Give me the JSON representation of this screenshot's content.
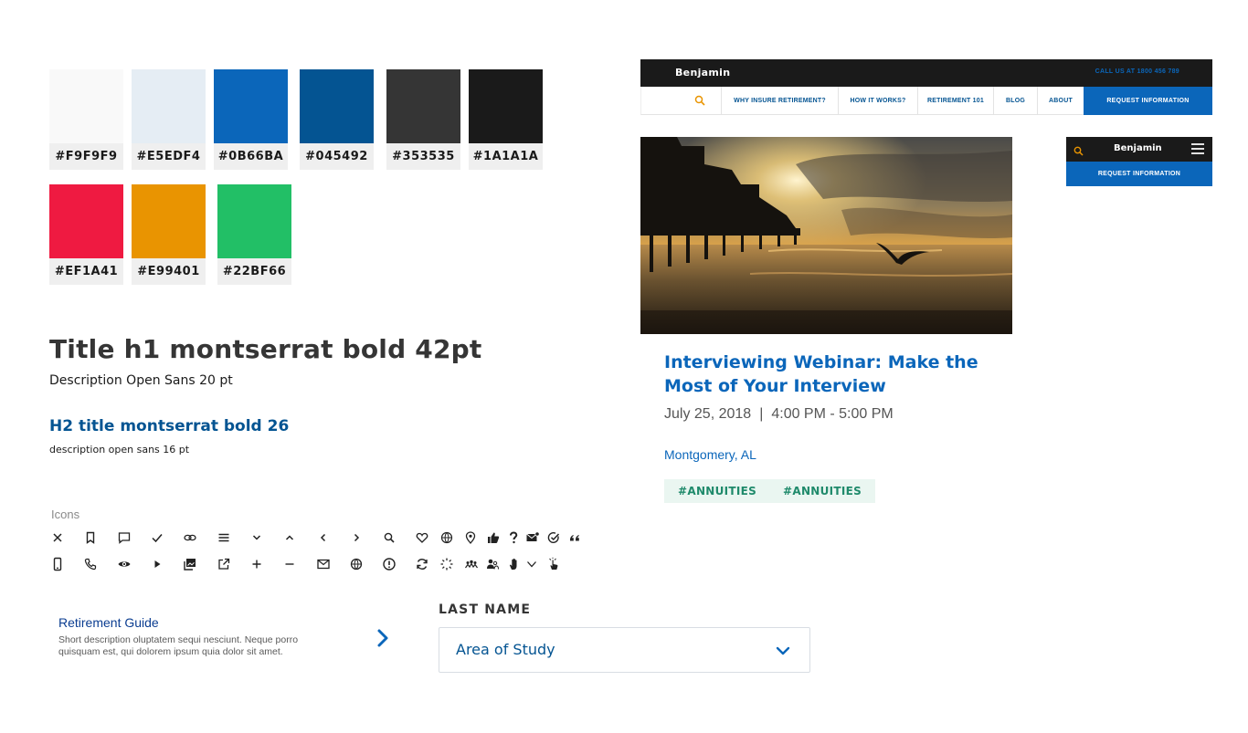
{
  "swatches": [
    {
      "hex": "#F9F9F9",
      "label": "#F9F9F9"
    },
    {
      "hex": "#E5EDF4",
      "label": "#E5EDF4"
    },
    {
      "hex": "#0B66BA",
      "label": "#0B66BA"
    },
    {
      "hex": "#045492",
      "label": "#045492"
    },
    {
      "hex": "#353535",
      "label": "#353535"
    },
    {
      "hex": "#1A1A1A",
      "label": "#1A1A1A"
    },
    {
      "hex": "#EF1A41",
      "label": "#EF1A41"
    },
    {
      "hex": "#E99401",
      "label": "#E99401"
    },
    {
      "hex": "#22BF66",
      "label": "#22BF66"
    }
  ],
  "typography": {
    "h1": "Title h1 montserrat bold 42pt",
    "h1_desc": "Description Open Sans 20 pt",
    "h2": "H2 title montserrat bold 26",
    "h2_desc": "description open sans 16 pt"
  },
  "icons": {
    "title": "Icons",
    "row1": [
      "close",
      "bookmark",
      "comment",
      "check",
      "link",
      "menu",
      "chevron-down",
      "chevron-up",
      "chevron-left",
      "chevron-right",
      "search",
      "heart",
      "globe",
      "location-pin",
      "thumbs-up",
      "question",
      "mail-badge",
      "check-circle",
      "quote"
    ],
    "row2": [
      "mobile",
      "phone",
      "eye",
      "play",
      "gallery",
      "external-link",
      "plus",
      "minus",
      "mail",
      "globe",
      "alert-circle",
      "refresh",
      "spinner",
      "group",
      "user-group",
      "hand",
      "chevron-down-small",
      "pointer"
    ]
  },
  "guide": {
    "title": "Retirement Guide",
    "description": "Short description oluptatem sequi nesciunt. Neque porro quisquam est, qui dolorem ipsum quia dolor sit amet."
  },
  "last_name": {
    "label": "LAST NAME",
    "value": "Area of Study"
  },
  "desktop_header": {
    "brand": "Benjamin",
    "call": "CALL US AT 1800 456 789",
    "nav": [
      "WHY INSURE RETIREMENT?",
      "HOW IT WORKS?",
      "RETIREMENT 101",
      "BLOG",
      "ABOUT"
    ],
    "cta": "REQUEST INFORMATION"
  },
  "mobile_header": {
    "brand": "Benjamin",
    "cta": "REQUEST INFORMATION"
  },
  "event": {
    "title": "Interviewing Webinar: Make the Most of Your Interview",
    "date": "July 25, 2018",
    "separator": "|",
    "time": "4:00 PM - 5:00 PM",
    "location": "Montgomery, AL",
    "tags": [
      "#ANNUITIES",
      "#ANNUITIES"
    ]
  },
  "colors": {
    "primary": "#0B66BA",
    "primary_dark": "#045492",
    "accent": "#E99401",
    "dark": "#1A1A1A"
  }
}
